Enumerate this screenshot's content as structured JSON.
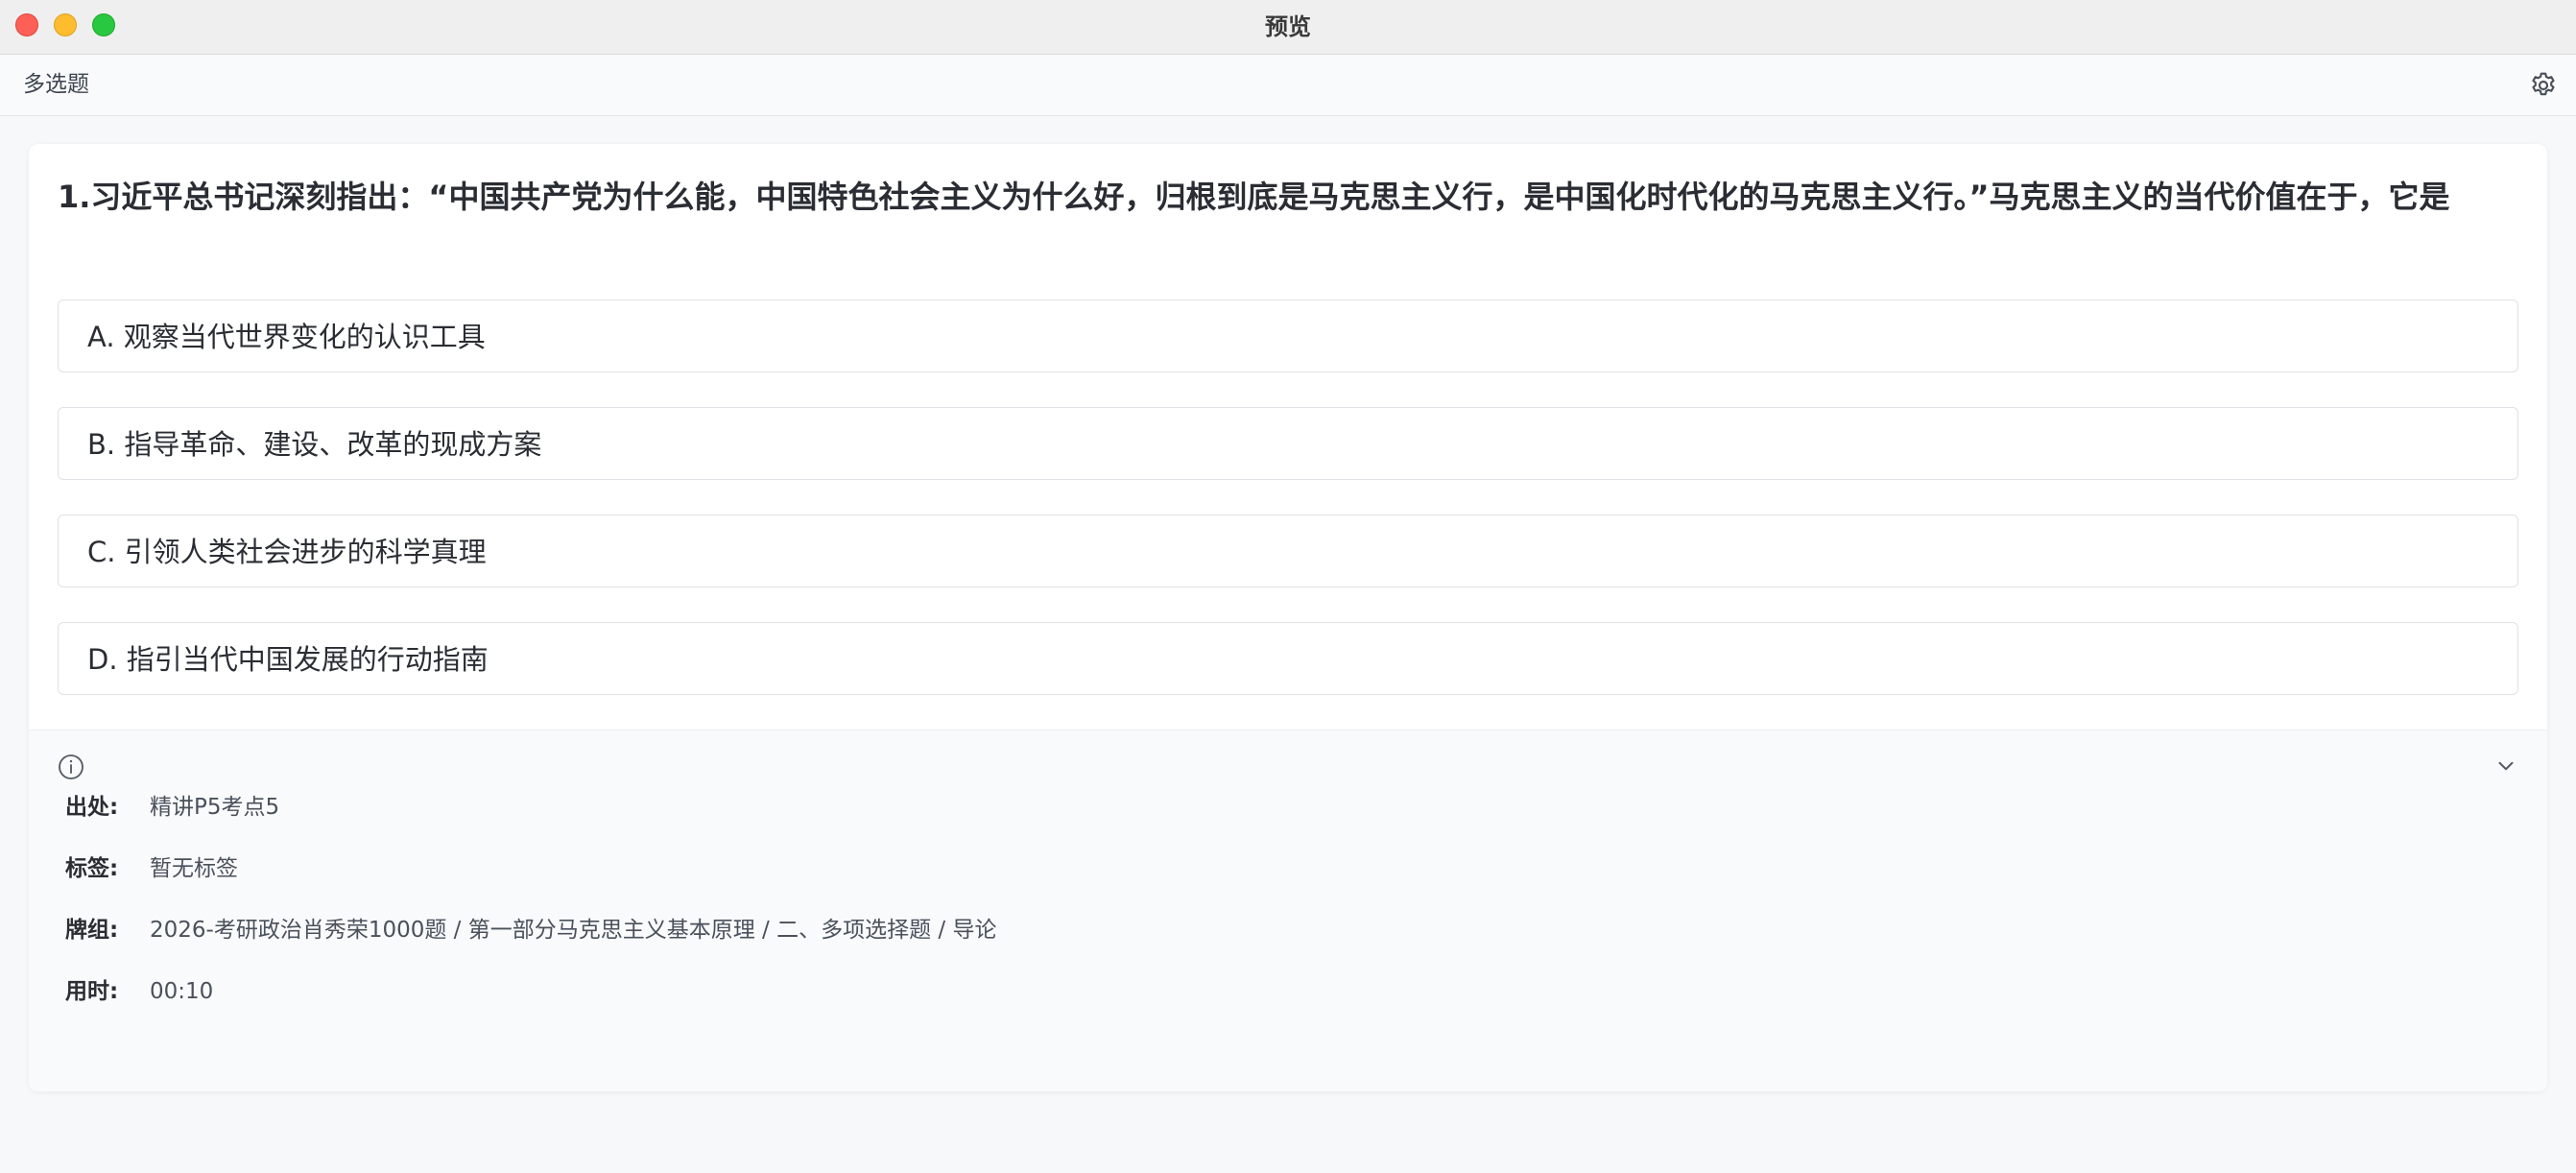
{
  "window": {
    "title": "预览"
  },
  "toolbar": {
    "question_type": "多选题",
    "settings_icon": "gear-icon"
  },
  "question": {
    "text": "1.习近平总书记深刻指出：“中国共产党为什么能，中国特色社会主义为什么好，归根到底是马克思主义行，是中国化时代化的马克思主义行。”马克思主义的当代价值在于，它是"
  },
  "options": [
    {
      "label": "A. 观察当代世界变化的认识工具"
    },
    {
      "label": "B. 指导革命、建设、改革的现成方案"
    },
    {
      "label": "C. 引领人类社会进步的科学真理"
    },
    {
      "label": "D. 指引当代中国发展的行动指南"
    }
  ],
  "info": {
    "info_icon": "info-icon",
    "collapse_icon": "chevron-down-icon",
    "source_label": "出处:",
    "source_value": "精讲P5考点5",
    "tags_label": "标签:",
    "tags_value": "暂无标签",
    "deck_label": "牌组:",
    "deck_value": "2026-考研政治肖秀荣1000题 / 第一部分马克思主义基本原理 / 二、多项选择题 / 导论",
    "time_label": "用时:",
    "time_value": "00:10"
  },
  "colors": {
    "close": "#fe5f57",
    "minimize": "#febc2e",
    "zoom": "#28c840"
  }
}
